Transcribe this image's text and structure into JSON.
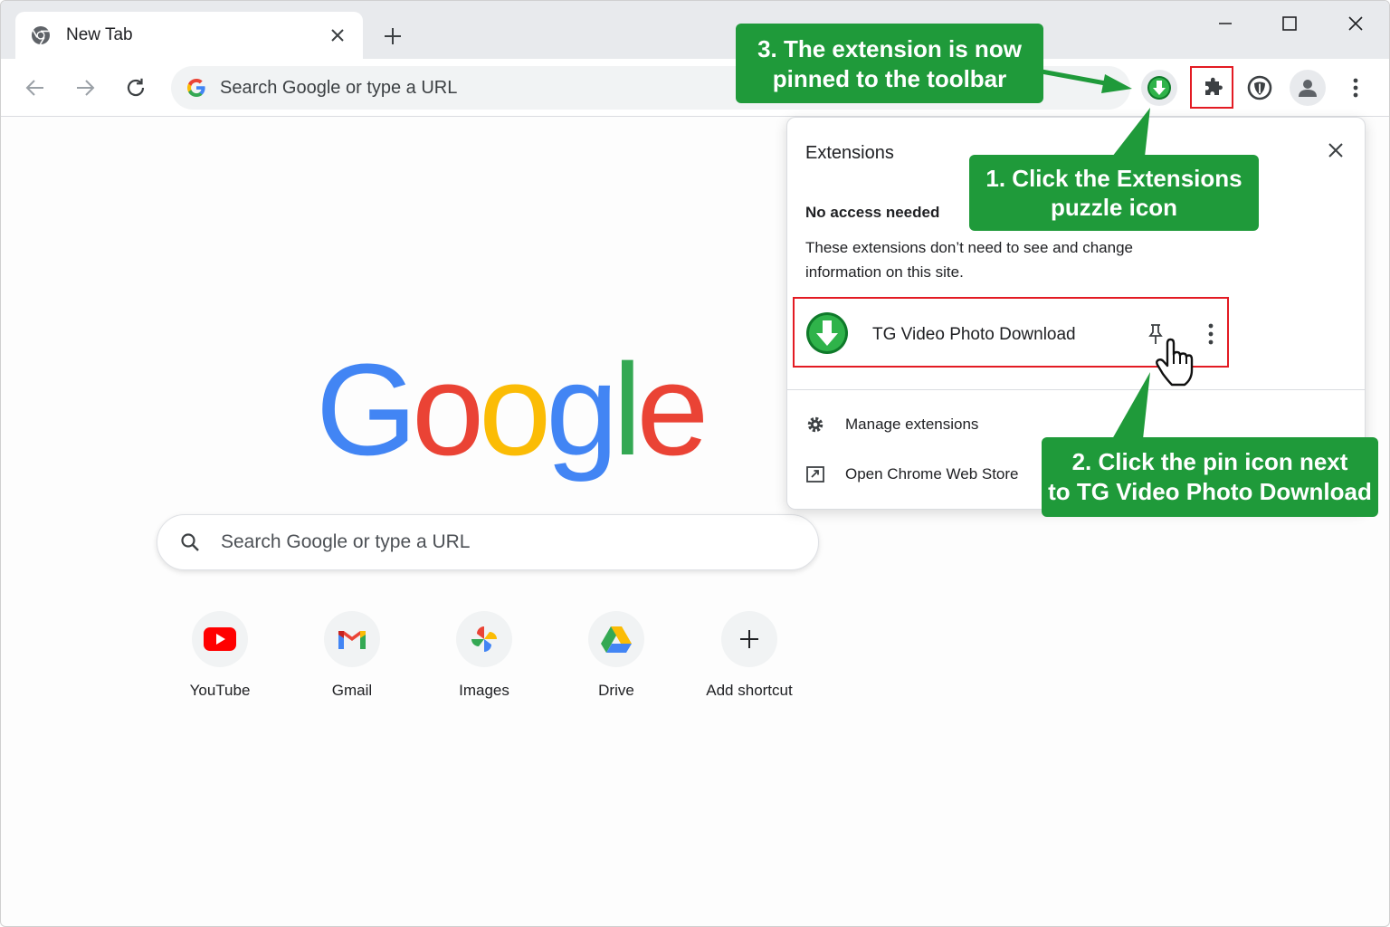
{
  "tab": {
    "title": "New Tab"
  },
  "omnibox": {
    "placeholder": "Search Google or type a URL"
  },
  "logo": {
    "letters": [
      "G",
      "o",
      "o",
      "g",
      "l",
      "e"
    ]
  },
  "search": {
    "placeholder": "Search Google or type a URL"
  },
  "shortcuts": [
    {
      "label": "YouTube"
    },
    {
      "label": "Gmail"
    },
    {
      "label": "Images"
    },
    {
      "label": "Drive"
    },
    {
      "label": "Add shortcut"
    }
  ],
  "extensions_popup": {
    "title": "Extensions",
    "section_title": "No access needed",
    "section_desc": "These extensions don’t need to see and change information on this site.",
    "item_name": "TG Video Photo Download",
    "manage_label": "Manage extensions",
    "store_label": "Open Chrome Web Store"
  },
  "callouts": {
    "step1_line1": "1. Click the Extensions",
    "step1_line2": "puzzle icon",
    "step2_line1": "2. Click the pin icon next",
    "step2_line2": "to TG Video Photo Download",
    "step3_line1": "3. The extension is now",
    "step3_line2": "pinned to the toolbar"
  },
  "colors": {
    "callout_green": "#1f9a3a",
    "highlight_red": "#e31b23",
    "google_blue": "#4285f4",
    "google_red": "#ea4335",
    "google_yellow": "#fbbc05",
    "google_green": "#34a853"
  },
  "icons": [
    "chrome-icon",
    "close-icon",
    "plus-icon",
    "minimize-icon",
    "maximize-icon",
    "back-arrow-icon",
    "forward-arrow-icon",
    "reload-icon",
    "google-g-icon",
    "download-extension-icon",
    "puzzle-icon",
    "shield-icon",
    "profile-icon",
    "kebab-menu-icon",
    "search-icon",
    "youtube-icon",
    "gmail-icon",
    "photos-icon",
    "drive-icon",
    "pin-icon",
    "hand-cursor-icon",
    "gear-icon",
    "store-icon"
  ]
}
